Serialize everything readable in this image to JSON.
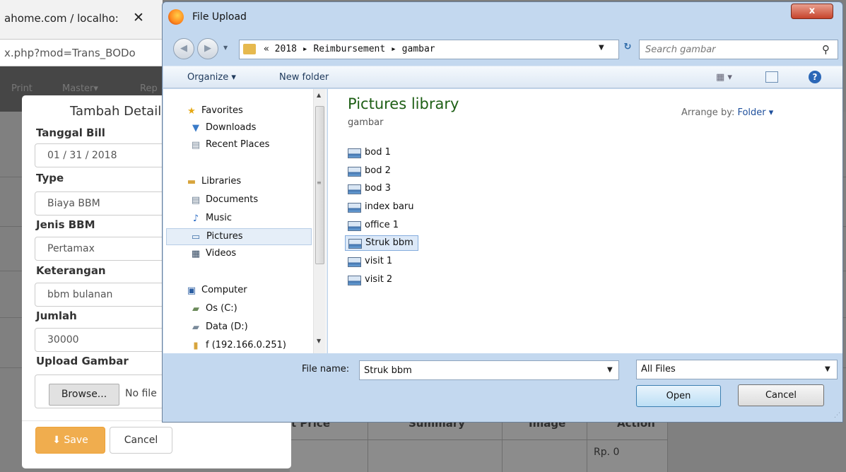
{
  "browser": {
    "tab_title": "ahome.com / localho:",
    "tab_close": "✕",
    "url": "x.php?mod=Trans_BODo",
    "nav_items": [
      "Print",
      "Master▾",
      "Rep"
    ]
  },
  "background_table": {
    "headers": [
      "t Price",
      "Summary",
      "Image",
      "Action"
    ],
    "amount": "Rp. 0"
  },
  "modal": {
    "title": "Tambah Detail",
    "fields": [
      {
        "label": "Tanggal Bill",
        "value": "01 / 31 / 2018"
      },
      {
        "label": "Type",
        "value": "Biaya BBM"
      },
      {
        "label": "Jenis BBM",
        "value": "Pertamax"
      },
      {
        "label": "Keterangan",
        "value": "bbm bulanan"
      },
      {
        "label": "Jumlah",
        "value": "30000"
      }
    ],
    "upload_label": "Upload Gambar",
    "browse_label": "Browse...",
    "no_file_text": "No file",
    "save_label": "Save",
    "cancel_label": "Cancel",
    "save_color": "#f0ad4e"
  },
  "dialog": {
    "title": "File Upload",
    "close_label": "x",
    "breadcrumb": "« 2018 ▸ Reimbursement ▸ gambar",
    "search_placeholder": "Search gambar",
    "organize_label": "Organize ▾",
    "new_folder_label": "New folder",
    "nav_pane": [
      {
        "label": "Favorites",
        "icon": "star-icon"
      },
      {
        "label": "Downloads",
        "icon": "downloads-folder-icon"
      },
      {
        "label": "Recent Places",
        "icon": "recent-places-icon"
      },
      {
        "label": "Libraries",
        "icon": "libraries-icon"
      },
      {
        "label": "Documents",
        "icon": "documents-icon"
      },
      {
        "label": "Music",
        "icon": "music-icon"
      },
      {
        "label": "Pictures",
        "icon": "pictures-icon"
      },
      {
        "label": "Videos",
        "icon": "videos-icon"
      },
      {
        "label": "Computer",
        "icon": "computer-icon"
      },
      {
        "label": "Os (C:)",
        "icon": "drive-icon"
      },
      {
        "label": "Data (D:)",
        "icon": "drive-icon"
      },
      {
        "label": "f (192.166.0.251)",
        "icon": "network-drive-icon"
      }
    ],
    "library_title": "Pictures library",
    "library_subtitle": "gambar",
    "arrange_label": "Arrange by:",
    "arrange_value": "Folder ▾",
    "files": [
      "bod 1",
      "bod 2",
      "bod 3",
      "index baru",
      "office 1",
      "Struk bbm",
      "visit 1",
      "visit 2"
    ],
    "selected_file": "Struk bbm",
    "file_name_label": "File name:",
    "file_name_value": "Struk bbm",
    "file_type_value": "All Files",
    "open_label": "Open",
    "cancel_label": "Cancel"
  },
  "colors": {
    "library_title": "#1e5f15",
    "dialog_frame": "#c3d8ef",
    "close_button": "#c7442c"
  }
}
